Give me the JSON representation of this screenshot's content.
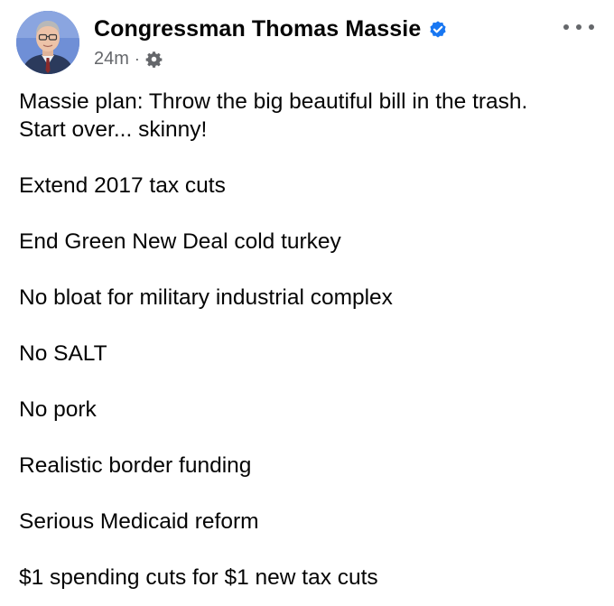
{
  "post": {
    "author": "Congressman Thomas Massie",
    "timestamp": "24m",
    "separator": "·",
    "audience_icon": "gear-icon",
    "verified_icon": "verified-badge-icon",
    "more_icon": "more-options-icon",
    "body": {
      "intro_line1": "Massie plan: Throw the big beautiful bill in the trash.",
      "intro_line2": "Start over... skinny!",
      "items": [
        "Extend 2017 tax cuts",
        "End Green New Deal cold turkey",
        "No bloat for military industrial complex",
        "No SALT",
        "No pork",
        "Realistic border funding",
        "Serious Medicaid reform",
        "$1 spending cuts for $1 new tax cuts"
      ]
    }
  },
  "colors": {
    "text": "#050505",
    "secondary_text": "#65676b",
    "verified_blue": "#1877f2"
  }
}
